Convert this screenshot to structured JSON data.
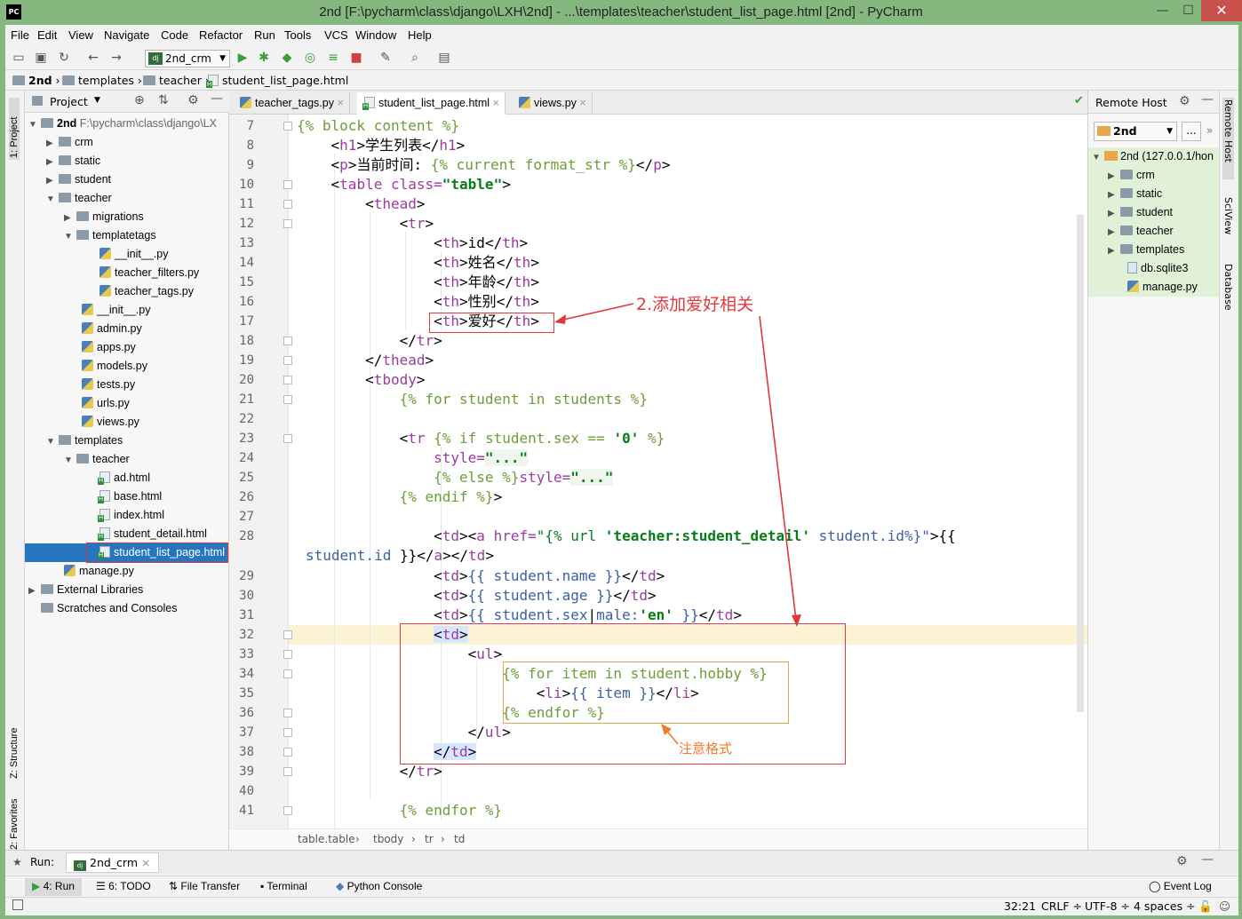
{
  "window": {
    "title": "2nd [F:\\pycharm\\class\\django\\LXH\\2nd] - ...\\templates\\teacher\\student_list_page.html [2nd] - PyCharm",
    "logo": "PC",
    "minimize": "—",
    "maximize": "☐",
    "close": "✕"
  },
  "menu": [
    "File",
    "Edit",
    "View",
    "Navigate",
    "Code",
    "Refactor",
    "Run",
    "Tools",
    "VCS",
    "Window",
    "Help"
  ],
  "toolbar": {
    "run_config": "2nd_crm"
  },
  "nav": {
    "project": "2nd",
    "folder1": "templates",
    "folder2": "teacher",
    "file": "student_list_page.html"
  },
  "project_panel": {
    "title": "Project",
    "root": "2nd",
    "root_path": "F:\\pycharm\\class\\django\\LX",
    "items": [
      "crm",
      "static",
      "student",
      "teacher",
      "migrations",
      "templatetags",
      "__init__.py",
      "teacher_filters.py",
      "teacher_tags.py",
      "__init__.py",
      "admin.py",
      "apps.py",
      "models.py",
      "tests.py",
      "urls.py",
      "views.py",
      "templates",
      "teacher",
      "ad.html",
      "base.html",
      "index.html",
      "student_detail.html",
      "student_list_page.html",
      "manage.py",
      "External Libraries",
      "Scratches and Consoles"
    ]
  },
  "left_stripe": {
    "project": "1: Project",
    "structure": "Z: Structure",
    "favorites": "2: Favorites"
  },
  "tabs": [
    "teacher_tags.py",
    "student_list_page.html",
    "views.py"
  ],
  "code": {
    "l7": "{% block content %}",
    "l8a": "<",
    "l8b": "h1",
    ">": ">",
    "l8c": "学生列表",
    "l8d": "</",
    "l8e": "h1",
    "l8f": ">",
    "lines": [
      "7",
      "8",
      "9",
      "10",
      "11",
      "12",
      "13",
      "14",
      "15",
      "16",
      "17",
      "18",
      "19",
      "20",
      "21",
      "22",
      "23",
      "24",
      "25",
      "26",
      "27",
      "28",
      "29",
      "30",
      "31",
      "32",
      "33",
      "34",
      "35",
      "36",
      "37",
      "38",
      "39",
      "40",
      "41"
    ]
  },
  "code_text": {
    "c9a": "当前时间: ",
    "c9b": "{% current format_str %}",
    "c10": "table class=",
    "c10s": "\"table\"",
    "c11": "thead",
    "c12": "tr",
    "c13": "id",
    "c14": "姓名",
    "c15": "年龄",
    "c16": "性别",
    "c17": "爱好",
    "c20": "tbody",
    "c21": "{% for student in students %}",
    "c23a": "tr ",
    "c23b": "{% if student.sex == ",
    "c23c": "'0'",
    "c23d": " %}",
    "c24a": "style=",
    "c24b": "\"...\"",
    "c25a": "{% else %}",
    "c25b": "style=",
    "c25c": "\"...\"",
    "c26": "{% endif %}",
    "c28a": "td",
    "c28b": "a href=",
    "c28c": "\"{% url ",
    "c28d": "'teacher:student_detail'",
    "c28e": " student.id%}\"",
    "c28f": "{{",
    "c28g": "student.id ",
    "c28h": "}}",
    "c29": "{{ student.name }}",
    "c30": "{{ student.age }}",
    "c31a": "{{ student.sex",
    "c31b": "male:",
    "c31c": "'en'",
    "c31d": " }}",
    "c33": "ul",
    "c34": "{% for item in student.hobby %}",
    "c35a": "li",
    "c35b": "{{ item }}",
    "c36": "{% endfor %}",
    "c41": "{% endfor %}"
  },
  "annotations": {
    "a1": "2.添加爱好相关",
    "a2": "注意格式"
  },
  "editor_breadcrumb": [
    "table.table",
    "tbody",
    "tr",
    "td"
  ],
  "remote": {
    "title": "Remote Host",
    "server": "2nd",
    "more": "...",
    "root": "2nd (127.0.0.1/hon",
    "items": [
      "crm",
      "static",
      "student",
      "teacher",
      "templates",
      "db.sqlite3",
      "manage.py"
    ]
  },
  "right_stripe": {
    "remote": "Remote Host",
    "sciview": "SciView",
    "database": "Database"
  },
  "run_bar": {
    "label": "Run:",
    "config": "2nd_crm"
  },
  "bottom_tools": [
    "4: Run",
    "6: TODO",
    "File Transfer",
    "Terminal",
    "Python Console"
  ],
  "event_log": "Event Log",
  "status": {
    "pos": "32:21",
    "eol": "CRLF",
    "enc": "UTF-8",
    "indent": "4 spaces"
  }
}
